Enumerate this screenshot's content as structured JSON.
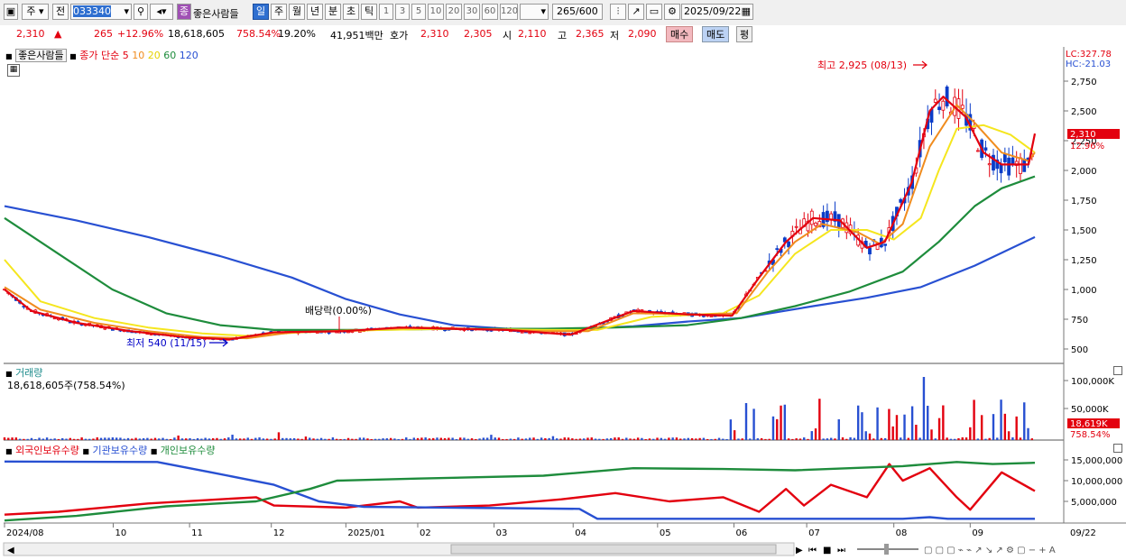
{
  "toolbar": {
    "market": "주",
    "prev": "전",
    "code": "033340",
    "name_badge": "종",
    "name": "좋은사람들",
    "periods": [
      "일",
      "주",
      "월",
      "년",
      "분",
      "초",
      "틱"
    ],
    "active_period": "일",
    "intervals": [
      "1",
      "3",
      "5",
      "10",
      "20",
      "30",
      "60",
      "120"
    ],
    "count": "265",
    "count_total": "/600",
    "date": "2025/09/22"
  },
  "quote": {
    "price": "2,310",
    "arrow": "▲",
    "change": "265",
    "change_pct": "+12.96%",
    "volume": "18,618,605",
    "vol_ratio": "758.54%",
    "turnover": "19.20%",
    "amount": "41,951백만",
    "bid_label": "호가",
    "bid1": "2,310",
    "bid2": "2,305",
    "open_label": "시",
    "open": "2,110",
    "high_label": "고",
    "high": "2,365",
    "low_label": "저",
    "low": "2,090",
    "buy": "매수",
    "sell": "매도",
    "eval": "평"
  },
  "price_pane": {
    "name": "좋은사람들",
    "legend_title": "종가 단순",
    "ma_periods": [
      "5",
      "10",
      "20",
      "60",
      "120"
    ],
    "ma_colors": [
      "#e3000f",
      "#f08c1e",
      "#f5e61e",
      "#1e8c3c",
      "#2850d2"
    ],
    "lc": "LC:327.78",
    "hc": "HC:-21.03",
    "price_tag": "2,310",
    "pct_tag": "12.96%",
    "y_ticks": [
      "2,750",
      "2,500",
      "2,250",
      "2,000",
      "1,750",
      "1,500",
      "1,250",
      "1,000",
      "750",
      "500"
    ],
    "high_note": "최고 2,925 (08/13)",
    "low_note": "최저 540 (11/15)",
    "dividend_note": "배당락(0.00%)"
  },
  "volume_pane": {
    "title": "거래량",
    "value": "18,618,605주(758.54%)",
    "y_ticks": [
      "100,000K",
      "50,000K"
    ],
    "tag": "18,619K",
    "tag_pct": "758.54%"
  },
  "holdings_pane": {
    "series": [
      "외국인보유수량",
      "기관보유수량",
      "개인보유수량"
    ],
    "series_colors": [
      "#e3000f",
      "#2850d2",
      "#1e8c3c"
    ],
    "y_ticks": [
      "15,000,000",
      "10,000,000",
      "5,000,000"
    ]
  },
  "x_axis": [
    "2024/08",
    "10",
    "11",
    "12",
    "2025/01",
    "02",
    "03",
    "04",
    "05",
    "06",
    "07",
    "08",
    "09"
  ],
  "x_right": "09/22",
  "chart_data": [
    {
      "type": "line",
      "title": "",
      "y_ticks": [
        500,
        750,
        1000,
        1250,
        1500,
        1750,
        2000,
        2250,
        2500,
        2750
      ],
      "series": [
        {
          "name": "5",
          "points": [
            [
              0,
              1000
            ],
            [
              30,
              820
            ],
            [
              80,
              720
            ],
            [
              140,
              650
            ],
            [
              200,
              600
            ],
            [
              250,
              580
            ],
            [
              300,
              640
            ],
            [
              380,
              650
            ],
            [
              440,
              680
            ],
            [
              500,
              670
            ],
            [
              560,
              660
            ],
            [
              630,
              620
            ],
            [
              700,
              820
            ],
            [
              760,
              790
            ],
            [
              810,
              780
            ],
            [
              840,
              1100
            ],
            [
              870,
              1400
            ],
            [
              900,
              1600
            ],
            [
              930,
              1580
            ],
            [
              960,
              1350
            ],
            [
              980,
              1400
            ],
            [
              1010,
              1900
            ],
            [
              1030,
              2500
            ],
            [
              1045,
              2620
            ],
            [
              1070,
              2450
            ],
            [
              1090,
              2150
            ],
            [
              1110,
              2050
            ],
            [
              1140,
              2050
            ],
            [
              1147,
              2310
            ]
          ]
        },
        {
          "name": "10",
          "points": [
            [
              0,
              1020
            ],
            [
              40,
              830
            ],
            [
              100,
              720
            ],
            [
              160,
              650
            ],
            [
              220,
              600
            ],
            [
              270,
              590
            ],
            [
              320,
              640
            ],
            [
              400,
              660
            ],
            [
              460,
              680
            ],
            [
              520,
              670
            ],
            [
              600,
              650
            ],
            [
              650,
              650
            ],
            [
              700,
              800
            ],
            [
              780,
              790
            ],
            [
              815,
              800
            ],
            [
              850,
              1150
            ],
            [
              880,
              1400
            ],
            [
              910,
              1550
            ],
            [
              950,
              1480
            ],
            [
              975,
              1380
            ],
            [
              1000,
              1550
            ],
            [
              1030,
              2200
            ],
            [
              1060,
              2550
            ],
            [
              1080,
              2400
            ],
            [
              1110,
              2150
            ],
            [
              1140,
              2080
            ],
            [
              1147,
              2150
            ]
          ]
        },
        {
          "name": "20",
          "points": [
            [
              0,
              1250
            ],
            [
              40,
              900
            ],
            [
              100,
              760
            ],
            [
              160,
              680
            ],
            [
              220,
              630
            ],
            [
              270,
              610
            ],
            [
              330,
              640
            ],
            [
              420,
              660
            ],
            [
              500,
              670
            ],
            [
              600,
              660
            ],
            [
              660,
              660
            ],
            [
              720,
              770
            ],
            [
              800,
              800
            ],
            [
              840,
              950
            ],
            [
              880,
              1300
            ],
            [
              920,
              1500
            ],
            [
              960,
              1500
            ],
            [
              990,
              1420
            ],
            [
              1020,
              1600
            ],
            [
              1040,
              2000
            ],
            [
              1060,
              2350
            ],
            [
              1090,
              2380
            ],
            [
              1120,
              2300
            ],
            [
              1147,
              2150
            ]
          ]
        },
        {
          "name": "60",
          "points": [
            [
              0,
              1600
            ],
            [
              60,
              1300
            ],
            [
              120,
              1000
            ],
            [
              180,
              800
            ],
            [
              240,
              700
            ],
            [
              300,
              660
            ],
            [
              400,
              660
            ],
            [
              500,
              670
            ],
            [
              600,
              670
            ],
            [
              680,
              680
            ],
            [
              760,
              700
            ],
            [
              820,
              760
            ],
            [
              880,
              860
            ],
            [
              940,
              980
            ],
            [
              1000,
              1150
            ],
            [
              1040,
              1400
            ],
            [
              1080,
              1700
            ],
            [
              1110,
              1850
            ],
            [
              1147,
              1950
            ]
          ]
        },
        {
          "name": "120",
          "points": [
            [
              0,
              1700
            ],
            [
              80,
              1580
            ],
            [
              160,
              1440
            ],
            [
              240,
              1280
            ],
            [
              320,
              1100
            ],
            [
              380,
              920
            ],
            [
              440,
              790
            ],
            [
              500,
              700
            ],
            [
              560,
              670
            ],
            [
              640,
              670
            ],
            [
              700,
              690
            ],
            [
              760,
              730
            ],
            [
              820,
              760
            ],
            [
              900,
              860
            ],
            [
              960,
              930
            ],
            [
              1020,
              1020
            ],
            [
              1080,
              1200
            ],
            [
              1147,
              1440
            ]
          ]
        }
      ]
    },
    {
      "type": "line",
      "title": "",
      "y_ticks": [
        5000000,
        10000000,
        15000000
      ],
      "series": [
        {
          "name": "외국인보유수량",
          "points": [
            [
              0,
              1800000
            ],
            [
              60,
              2500000
            ],
            [
              160,
              4500000
            ],
            [
              280,
              6000000
            ],
            [
              300,
              4000000
            ],
            [
              380,
              3500000
            ],
            [
              440,
              5000000
            ],
            [
              460,
              3500000
            ],
            [
              540,
              4000000
            ],
            [
              620,
              5500000
            ],
            [
              680,
              7000000
            ],
            [
              740,
              5000000
            ],
            [
              800,
              6000000
            ],
            [
              840,
              2500000
            ],
            [
              870,
              8000000
            ],
            [
              890,
              4000000
            ],
            [
              920,
              9000000
            ],
            [
              960,
              6000000
            ],
            [
              985,
              14000000
            ],
            [
              1000,
              10000000
            ],
            [
              1030,
              13000000
            ],
            [
              1060,
              6000000
            ],
            [
              1075,
              3000000
            ],
            [
              1110,
              12000000
            ],
            [
              1147,
              7500000
            ]
          ]
        },
        {
          "name": "기관보유수량",
          "points": [
            [
              0,
              14600000
            ],
            [
              170,
              14500000
            ],
            [
              230,
              12000000
            ],
            [
              300,
              9000000
            ],
            [
              350,
              5000000
            ],
            [
              400,
              3700000
            ],
            [
              640,
              3200000
            ],
            [
              660,
              800000
            ],
            [
              1000,
              800000
            ],
            [
              1030,
              1200000
            ],
            [
              1050,
              800000
            ],
            [
              1147,
              800000
            ]
          ]
        },
        {
          "name": "개인보유수량",
          "points": [
            [
              0,
              400000
            ],
            [
              80,
              1500000
            ],
            [
              180,
              3800000
            ],
            [
              280,
              5000000
            ],
            [
              340,
              8000000
            ],
            [
              370,
              10000000
            ],
            [
              460,
              10500000
            ],
            [
              600,
              11200000
            ],
            [
              700,
              13000000
            ],
            [
              800,
              12800000
            ],
            [
              880,
              12500000
            ],
            [
              1000,
              13500000
            ],
            [
              1060,
              14500000
            ],
            [
              1100,
              14000000
            ],
            [
              1147,
              14300000
            ]
          ]
        }
      ]
    }
  ]
}
